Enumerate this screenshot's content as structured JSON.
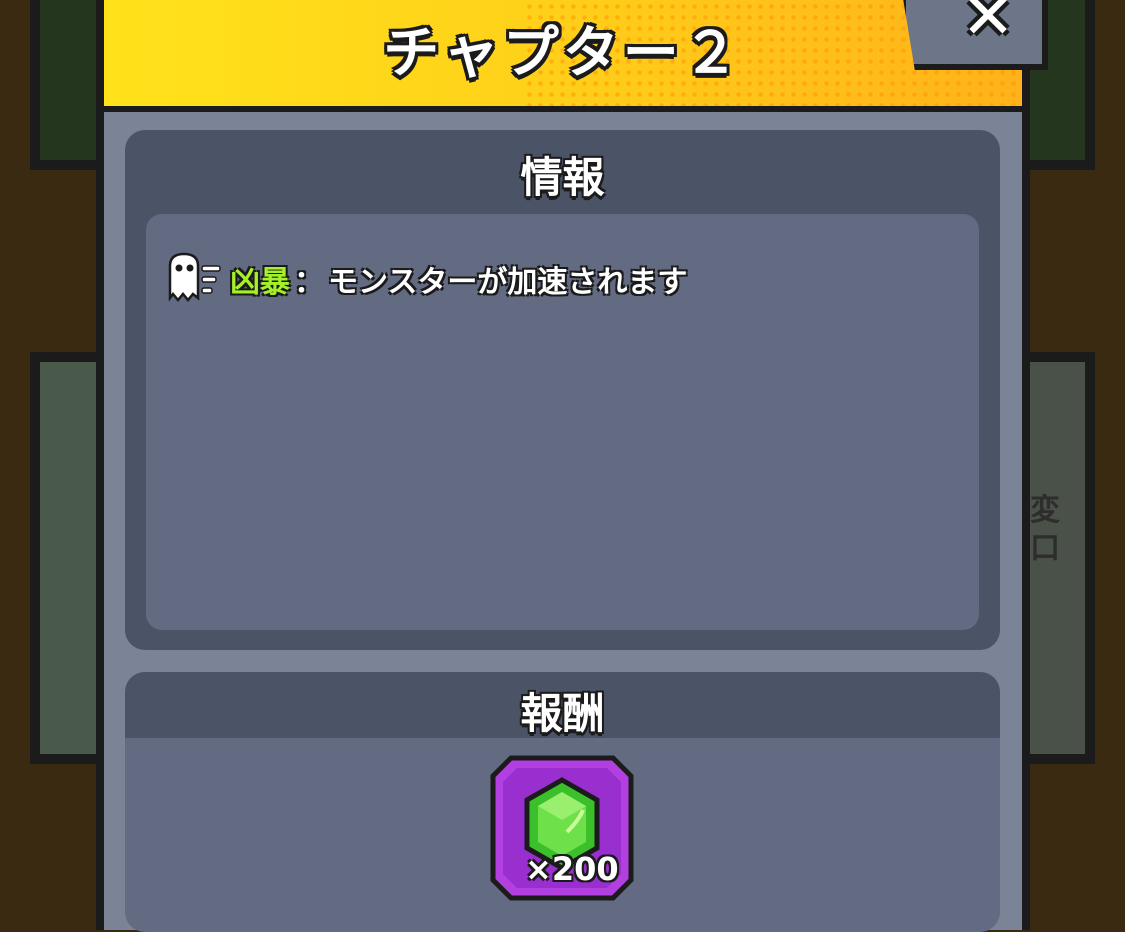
{
  "dialog": {
    "title": "チャプター２",
    "close_label": "✕"
  },
  "info": {
    "heading": "情報",
    "modifier": {
      "icon": "ghost-speed-icon",
      "tag": "凶暴",
      "separator": "：",
      "description": "モンスターが加速されます"
    }
  },
  "reward": {
    "heading": "報酬",
    "items": [
      {
        "icon": "green-gem-icon",
        "count": "×200"
      }
    ]
  },
  "background": {
    "glyph_text": "変口"
  },
  "colors": {
    "header_yellow": "#ffd21a",
    "panel": "#7b8397",
    "section_dark": "#4b5366",
    "section_light": "#636b82",
    "tag_green": "#a6f02a",
    "reward_frame": "#b23fe0"
  }
}
